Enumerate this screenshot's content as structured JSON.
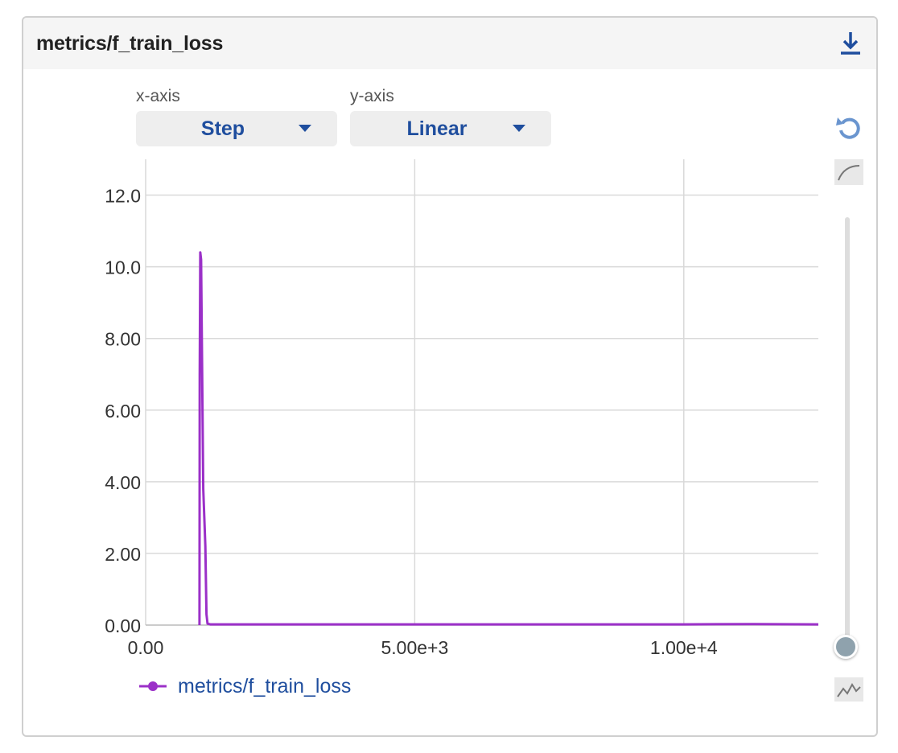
{
  "panel": {
    "title": "metrics/f_train_loss"
  },
  "controls": {
    "x_axis_label": "x-axis",
    "x_axis_value": "Step",
    "y_axis_label": "y-axis",
    "y_axis_value": "Linear"
  },
  "icons": {
    "download": "download-icon",
    "reset_zoom": "reset-icon",
    "smoothing": "smooth-curve-icon",
    "raw": "raw-line-icon"
  },
  "colors": {
    "series": "#9b30c8",
    "accent": "#1f4e9e"
  },
  "smoothing_slider": {
    "value": 0
  },
  "chart_data": {
    "type": "line",
    "title": "",
    "xlabel": "",
    "ylabel": "",
    "xlim": [
      0,
      12500
    ],
    "ylim": [
      0,
      13.0
    ],
    "x_ticks": [
      0,
      5000,
      10000
    ],
    "x_tick_labels": [
      "0.00",
      "5.00e+3",
      "1.00e+4"
    ],
    "y_ticks": [
      0,
      2,
      4,
      6,
      8,
      10,
      12
    ],
    "y_tick_labels": [
      "0.00",
      "2.00",
      "4.00",
      "6.00",
      "8.00",
      "10.0",
      "12.0"
    ],
    "grid": true,
    "legend": "bottom-left",
    "series": [
      {
        "name": "metrics/f_train_loss",
        "color": "#9b30c8",
        "x": [
          1000,
          1005,
          1015,
          1030,
          1070,
          1110,
          1130,
          1150,
          1200,
          1500,
          3000,
          5000,
          8000,
          10000,
          11300,
          12500
        ],
        "y": [
          0.0,
          7.0,
          10.4,
          10.2,
          3.8,
          2.2,
          0.3,
          0.04,
          0.02,
          0.02,
          0.02,
          0.02,
          0.02,
          0.02,
          0.03,
          0.02
        ]
      }
    ]
  }
}
